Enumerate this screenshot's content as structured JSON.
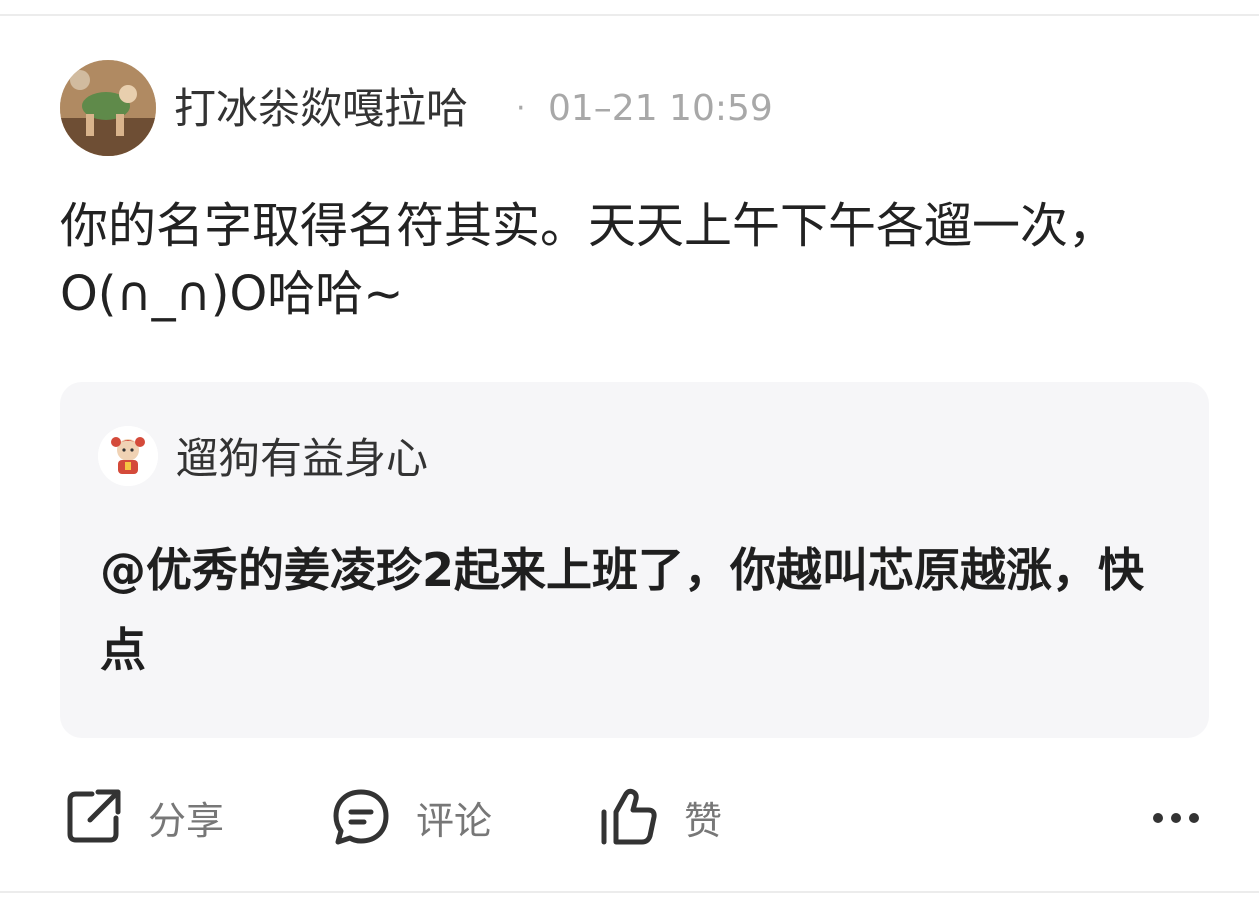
{
  "post": {
    "author": "打冰尜欻嘎拉哈",
    "separator": "·",
    "time": "01–21 10:59",
    "avatar_icon": "user-avatar-photo",
    "text": "你的名字取得名符其实。天天上午下午各遛一次，O(∩_∩)O哈哈~"
  },
  "quote": {
    "author": "遛狗有益身心",
    "avatar_icon": "cartoon-avatar-icon",
    "text": "@优秀的姜凌珍2起来上班了，你越叫芯原越涨，快点"
  },
  "actions": {
    "share_label": "分享",
    "share_icon": "share-icon",
    "comment_label": "评论",
    "comment_icon": "comment-icon",
    "like_label": "赞",
    "like_icon": "thumbs-up-icon",
    "more_icon": "more-icon"
  },
  "colors": {
    "primary_text": "#222222",
    "secondary_text": "#a8a8a8",
    "card_background": "#f6f6f8"
  }
}
